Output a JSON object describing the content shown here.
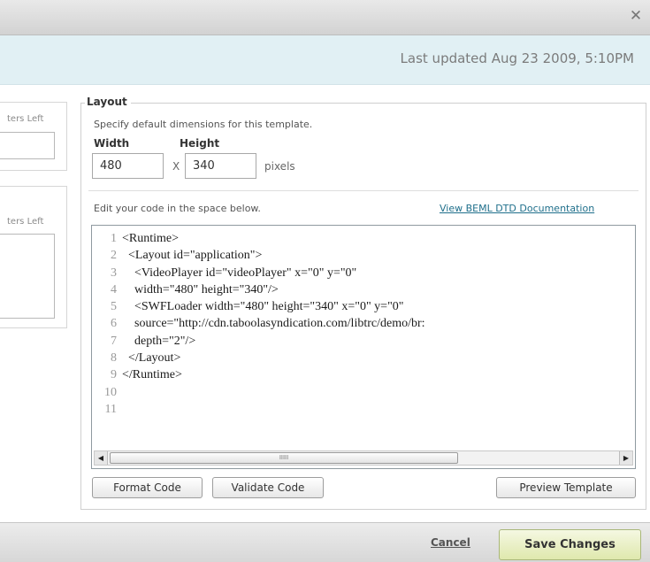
{
  "dialog": {
    "close_icon": "close-icon"
  },
  "info": {
    "last_updated": "Last updated Aug 23 2009, 5:10PM"
  },
  "left_panel": {
    "box1_label": "ters Left",
    "box2_label": "ters Left"
  },
  "layout": {
    "legend": "Layout",
    "description": "Specify default dimensions for this template.",
    "width_label": "Width",
    "height_label": "Height",
    "width_value": "480",
    "height_value": "340",
    "x_sep": "X",
    "pixels_label": "pixels",
    "edit_hint": "Edit your code in the space below.",
    "doc_link": "View BEML DTD Documentation"
  },
  "editor": {
    "lines": [
      {
        "num": "1",
        "code": "<Runtime>"
      },
      {
        "num": "2",
        "code": "  <Layout id=\"application\">"
      },
      {
        "num": "3",
        "code": "    <VideoPlayer id=\"videoPlayer\" x=\"0\" y=\"0\""
      },
      {
        "num": "4",
        "code": "    width=\"480\" height=\"340\"/>"
      },
      {
        "num": "5",
        "code": "    <SWFLoader width=\"480\" height=\"340\" x=\"0\" y=\"0\""
      },
      {
        "num": "6",
        "code": "    source=\"http://cdn.taboolasyndication.com/libtrc/demo/br:"
      },
      {
        "num": "7",
        "code": "    depth=\"2\"/>"
      },
      {
        "num": "8",
        "code": "  </Layout>"
      },
      {
        "num": "9",
        "code": "</Runtime>"
      },
      {
        "num": "10",
        "code": ""
      },
      {
        "num": "11",
        "code": ""
      }
    ],
    "scroll_left": "◀",
    "scroll_right": "▶",
    "scroll_grip": "IIIII"
  },
  "buttons": {
    "format_code": "Format Code",
    "validate_code": "Validate Code",
    "preview_template": "Preview Template"
  },
  "footer": {
    "cancel": "Cancel",
    "save": "Save Changes"
  }
}
